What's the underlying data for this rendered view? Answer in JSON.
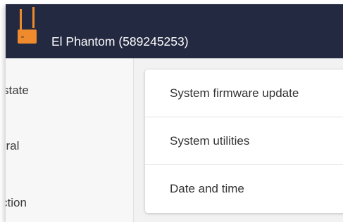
{
  "header": {
    "device_title": "El Phantom (589245253)",
    "icon": "router-icon",
    "icon_color": "#ef8b2c",
    "background": "#232941"
  },
  "sidebar": {
    "items": [
      {
        "label": "state"
      },
      {
        "label": "eral"
      },
      {
        "label": "ction"
      }
    ]
  },
  "menu": {
    "items": [
      {
        "label": "System firmware update"
      },
      {
        "label": "System utilities"
      },
      {
        "label": "Date and time"
      }
    ]
  }
}
